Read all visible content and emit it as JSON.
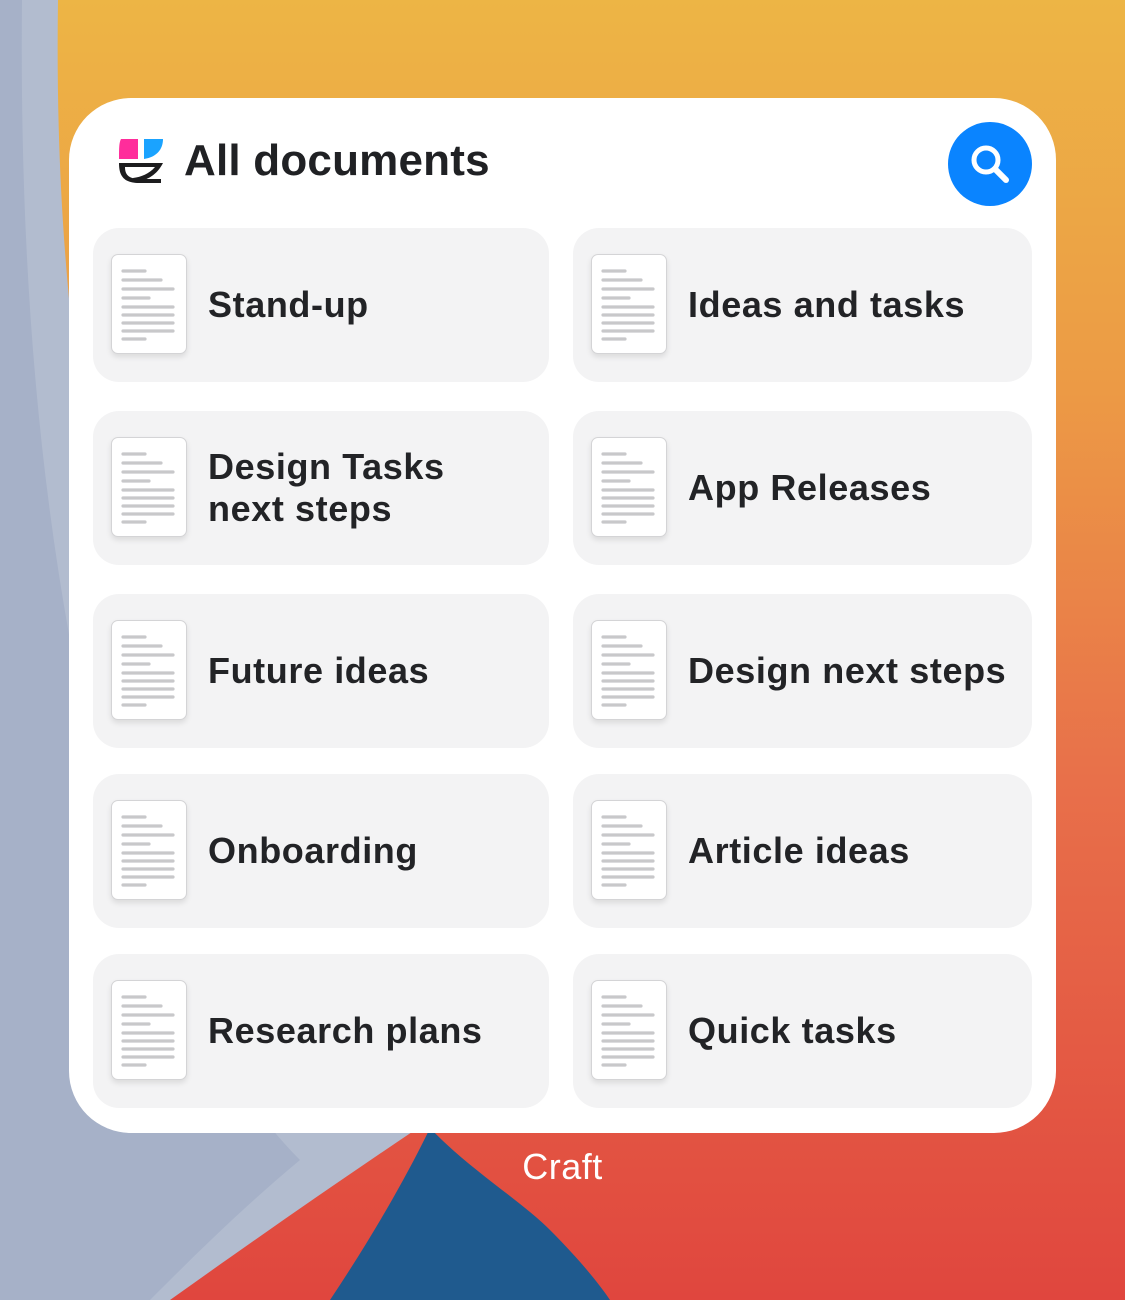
{
  "widget": {
    "title": "All documents",
    "search_icon": "magnifier-icon",
    "accent_color": "#0a84ff",
    "documents": [
      {
        "label": "Stand-up"
      },
      {
        "label": "Ideas and tasks"
      },
      {
        "label": "Design Tasks next steps"
      },
      {
        "label": "App Releases"
      },
      {
        "label": "Future ideas"
      },
      {
        "label": "Design next steps"
      },
      {
        "label": "Onboarding"
      },
      {
        "label": "Article ideas"
      },
      {
        "label": "Research plans"
      },
      {
        "label": "Quick tasks"
      }
    ]
  },
  "app_name": "Craft"
}
